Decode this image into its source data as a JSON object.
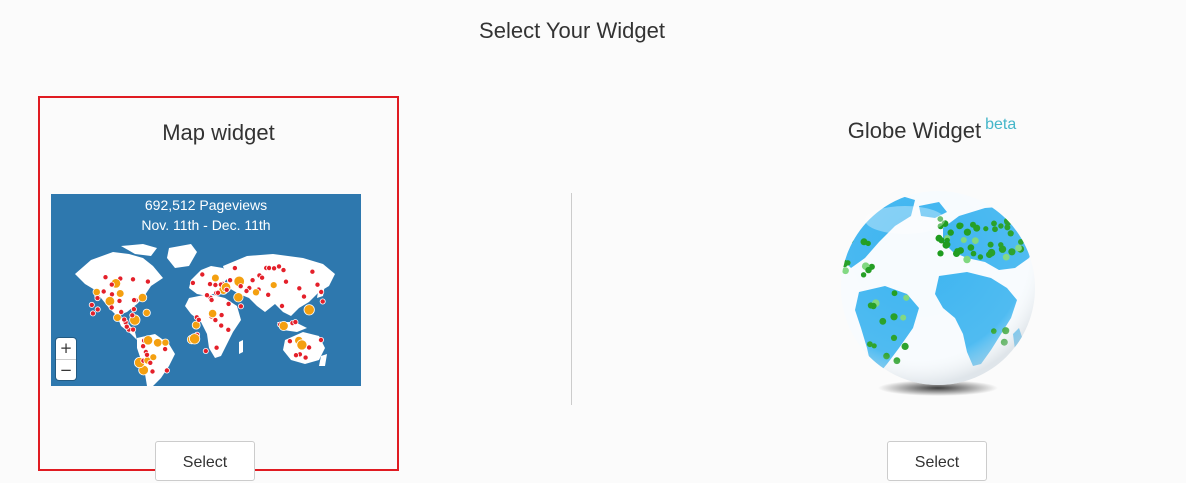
{
  "page": {
    "title": "Select Your Widget"
  },
  "widgets": [
    {
      "title": "Map widget",
      "caption_line1": "692,512 Pageviews",
      "caption_line2": "Nov. 11th - Dec. 11th",
      "zoom_in": "+",
      "zoom_out": "−",
      "select_label": "Select",
      "selected": true
    },
    {
      "title": "Globe Widget",
      "badge": "beta",
      "select_label": "Select",
      "selected": false
    }
  ],
  "colors": {
    "map_ocean": "#2e78ae",
    "map_land": "#ffffff",
    "dot_small": "#e4202a",
    "dot_large": "#f4a010",
    "globe_ocean": "#ffffff",
    "globe_land": "#3cb4f0",
    "globe_dot": "#1a9a1a",
    "selection_border": "#e01b22",
    "beta": "#45b6c9"
  },
  "icons": [
    "zoom-in-icon",
    "zoom-out-icon"
  ]
}
